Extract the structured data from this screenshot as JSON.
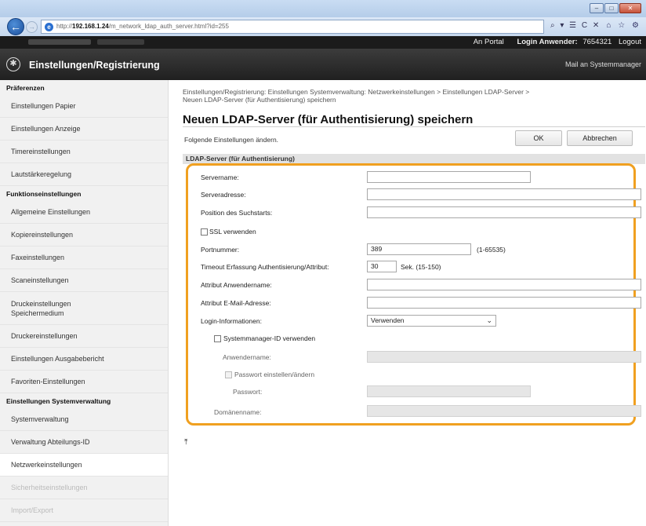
{
  "browser": {
    "url_prefix": "http://",
    "url_host": "192.168.1.24",
    "url_path": "/m_network_ldap_auth_server.html?id=255",
    "address_tools": "⌕ ▾ ☰ C ✕",
    "right_icons": "⌂ ☆ ⚙",
    "win_min": "–",
    "win_max": "□",
    "win_close": "✕"
  },
  "userbar": {
    "portal_link": "An Portal",
    "login_user_label": "Login Anwender:",
    "login_user_value": "7654321",
    "logout_link": "Logout"
  },
  "appbar": {
    "title": "Einstellungen/Registrierung",
    "mail_link": "Mail an Systemmanager"
  },
  "sidebar": {
    "section_preferences": "Präferenzen",
    "pref_items": [
      "Einstellungen Papier",
      "Einstellungen Anzeige",
      "Timereinstellungen",
      "Lautstärkeregelung"
    ],
    "section_function": "Funktionseinstellungen",
    "func_items": [
      "Allgemeine Einstellungen",
      "Kopiereinstellungen",
      "Faxeinstellungen",
      "Scaneinstellungen"
    ],
    "func_item_multiline": [
      "Druckeinstellungen",
      "Speichermedium"
    ],
    "func_items_2": [
      "Druckereinstellungen",
      "Einstellungen Ausgabebericht",
      "Favoriten-Einstellungen"
    ],
    "section_system": "Einstellungen Systemverwaltung",
    "sys_items": [
      "Systemverwaltung",
      "Verwaltung Abteilungs-ID",
      "Netzwerkeinstellungen",
      "Sicherheitseinstellungen",
      "Import/Export"
    ]
  },
  "main": {
    "breadcrumb_line1": "Einstellungen/Registrierung: Einstellungen Systemverwaltung: Netzwerkeinstellungen > Einstellungen LDAP-Server >",
    "breadcrumb_line2": "Neuen LDAP-Server (für Authentisierung) speichern",
    "title": "Neuen LDAP-Server (für Authentisierung) speichern",
    "instruction": "Folgende Einstellungen ändern.",
    "ok_button": "OK",
    "cancel_button": "Abbrechen",
    "section_header": "LDAP-Server (für Authentisierung)",
    "to_top": "⤒"
  },
  "form": {
    "server_name_label": "Servername:",
    "server_name_value": "",
    "server_address_label": "Serveradresse:",
    "server_address_value": "",
    "search_start_label": "Position des Suchstarts:",
    "search_start_value": "",
    "ssl_label": "SSL verwenden",
    "port_label": "Portnummer:",
    "port_value": "389",
    "port_hint": "(1-65535)",
    "timeout_label": "Timeout Erfassung Authentisierung/Attribut:",
    "timeout_value": "30",
    "timeout_hint": "Sek. (15-150)",
    "attr_username_label": "Attribut Anwendername:",
    "attr_username_value": "",
    "attr_email_label": "Attribut E-Mail-Adresse:",
    "attr_email_value": "",
    "login_info_label": "Login-Informationen:",
    "login_info_value": "Verwenden",
    "use_sysmgr_label": "Systemmanager-ID verwenden",
    "username_label": "Anwendername:",
    "set_password_label": "Passwort einstellen/ändern",
    "password_label": "Passwort:",
    "domain_label": "Domänenname:"
  },
  "colors": {
    "highlight_border": "#f0a020",
    "header_bar": "#202020"
  }
}
